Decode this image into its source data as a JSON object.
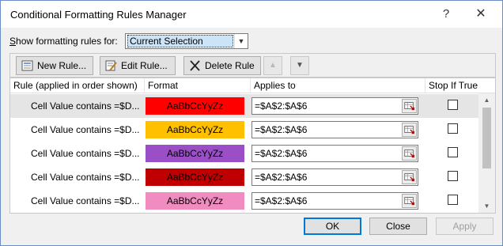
{
  "window": {
    "title": "Conditional Formatting Rules Manager",
    "help_glyph": "?",
    "close_glyph": "✕"
  },
  "scope": {
    "label_prefix": "S",
    "label_rest": "how formatting rules for:",
    "selected": "Current Selection"
  },
  "toolbar": {
    "new_rule": "New Rule...",
    "edit_rule": "Edit Rule...",
    "delete_rule": "Delete Rule",
    "move_up_glyph": "▲",
    "move_down_glyph": "▼"
  },
  "table": {
    "columns": [
      "Rule (applied in order shown)",
      "Format",
      "Applies to",
      "Stop If True"
    ],
    "rows": [
      {
        "rule": "Cell Value contains =$D...",
        "preview": "AaBbCcYyZz",
        "fill": "#ff0000",
        "applies_to": "=$A$2:$A$6",
        "stop_if_true": false,
        "selected": true
      },
      {
        "rule": "Cell Value contains =$D...",
        "preview": "AaBbCcYyZz",
        "fill": "#ffc000",
        "applies_to": "=$A$2:$A$6",
        "stop_if_true": false,
        "selected": false
      },
      {
        "rule": "Cell Value contains =$D...",
        "preview": "AaBbCcYyZz",
        "fill": "#9b4fc7",
        "applies_to": "=$A$2:$A$6",
        "stop_if_true": false,
        "selected": false
      },
      {
        "rule": "Cell Value contains =$D...",
        "preview": "AaBbCcYyZz",
        "fill": "#c00000",
        "applies_to": "=$A$2:$A$6",
        "stop_if_true": false,
        "selected": false
      },
      {
        "rule": "Cell Value contains =$D...",
        "preview": "AaBbCcYyZz",
        "fill": "#f08cbf",
        "applies_to": "=$A$2:$A$6",
        "stop_if_true": false,
        "selected": false
      }
    ]
  },
  "buttons": {
    "ok": "OK",
    "close": "Close",
    "apply": "Apply"
  },
  "colors": {
    "selection": "#cce4f7",
    "focus_border": "#0078d7"
  }
}
